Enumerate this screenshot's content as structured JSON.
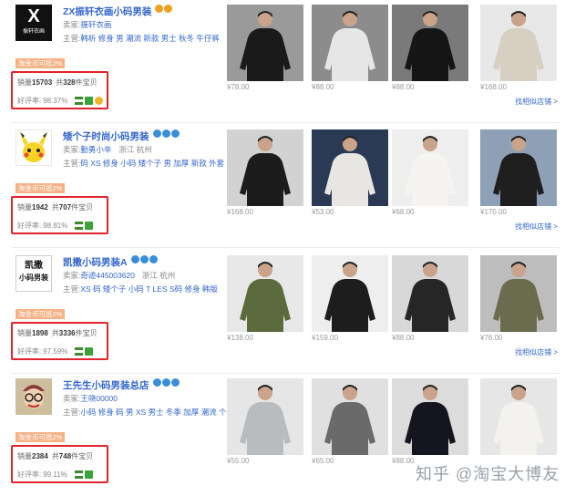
{
  "stores": [
    {
      "logo_text": [
        "X",
        "振轩衣画"
      ],
      "name": "ZX振轩衣画小码男装",
      "crowns": 2,
      "crown_color": "#f0a020",
      "seller_label": "卖家:",
      "seller_name": "振轩衣画",
      "location": "",
      "main_label": "主营:",
      "main_items": "韩析 修身 男 潮流 新款 男士 秋冬 牛仔裤",
      "badge": "淘金币可抵2%",
      "sales_label": "销量",
      "sales_value": "15703",
      "total_label": "共",
      "total_value": "328",
      "total_unit": "件宝贝",
      "rating_label": "好评率:",
      "rating_value": "98.37%",
      "rating_icons": [
        "list-icon",
        "shield-icon",
        "gold-medal-icon"
      ],
      "products": [
        {
          "price": "¥78.00",
          "bg": "#9a9a9a",
          "fg": "#1a1a1a"
        },
        {
          "price": "¥88.00",
          "bg": "#8c8c8c",
          "fg": "#e6e6e6"
        },
        {
          "price": "¥88.00",
          "bg": "#7a7a7a",
          "fg": "#151515"
        },
        {
          "price": "¥168.00",
          "bg": "#e8e8e8",
          "fg": "#d6cfc2"
        }
      ],
      "similar": "找相似店铺 >"
    },
    {
      "logo_text": [
        "Pikachu"
      ],
      "name": "矮个子时尚小码男装",
      "crowns": 3,
      "crown_color": "#3a8ed8",
      "seller_label": "卖家:",
      "seller_name": "勤勇小辛",
      "location": "浙江 杭州",
      "main_label": "主营:",
      "main_items": "码 XS 修身 小码 矮个子 男 加厚 新款 外套 上衣",
      "badge": "淘金币可抵2%",
      "sales_label": "销量",
      "sales_value": "1942",
      "total_label": "共",
      "total_value": "707",
      "total_unit": "件宝贝",
      "rating_label": "好评率:",
      "rating_value": "98.81%",
      "rating_icons": [
        "list-icon",
        "shield-icon"
      ],
      "products": [
        {
          "price": "¥168.00",
          "bg": "#d2d2d2",
          "fg": "#1c1c1c"
        },
        {
          "price": "¥53.00",
          "bg": "#2a3a55",
          "fg": "#e8e6e2"
        },
        {
          "price": "¥68.00",
          "bg": "#eeeeee",
          "fg": "#f6f4f0"
        },
        {
          "price": "¥170.00",
          "bg": "#8da0b5",
          "fg": "#1e1e1e"
        }
      ],
      "similar": "找相似店铺 >"
    },
    {
      "logo_text": [
        "凯撒",
        "小码男装"
      ],
      "name": "凯撒小码男装A",
      "crowns": 3,
      "crown_color": "#3a8ed8",
      "seller_label": "卖家:",
      "seller_name": "奇迹445003620",
      "location": "浙江 杭州",
      "main_label": "主营:",
      "main_items": "XS 码 矮个子 小码 T LES S码 修身 韩版",
      "badge": "淘金币可抵2%",
      "sales_label": "销量",
      "sales_value": "1898",
      "total_label": "共",
      "total_value": "3336",
      "total_unit": "件宝贝",
      "rating_label": "好评率:",
      "rating_value": "97.59%",
      "rating_icons": [
        "list-icon",
        "shield-icon"
      ],
      "products": [
        {
          "price": "¥138.00",
          "bg": "#e8e8e8",
          "fg": "#5c6b3e"
        },
        {
          "price": "¥159.00",
          "bg": "#eeeeee",
          "fg": "#1d1d1d"
        },
        {
          "price": "¥88.00",
          "bg": "#d8d8d8",
          "fg": "#262626"
        },
        {
          "price": "¥76.00",
          "bg": "#bdbdbd",
          "fg": "#6b6b4e"
        }
      ],
      "similar": "找相似店铺 >"
    },
    {
      "logo_text": [
        "Arale"
      ],
      "name": "王先生小码男装总店",
      "crowns": 3,
      "crown_color": "#3a8ed8",
      "seller_label": "卖家:",
      "seller_name": "王晓00000",
      "location": "",
      "main_label": "主营:",
      "main_items": "小码 修身 码 男 XS 男士 冬季 加厚 潮流 个",
      "badge": "淘金币可抵2%",
      "sales_label": "销量",
      "sales_value": "2384",
      "total_label": "共",
      "total_value": "748",
      "total_unit": "件宝贝",
      "rating_label": "好评率:",
      "rating_value": "99.11%",
      "rating_icons": [
        "list-icon",
        "shield-icon"
      ],
      "products": [
        {
          "price": "¥55.00",
          "bg": "#e6e6e6",
          "fg": "#b9bcbf"
        },
        {
          "price": "¥65.00",
          "bg": "#e0e0e0",
          "fg": "#6a6a6a"
        },
        {
          "price": "¥88.00",
          "bg": "#dcdcdc",
          "fg": "#151520"
        },
        {
          "price": "",
          "bg": "#e6e6e6",
          "fg": "#f4f2ee"
        }
      ],
      "similar": ""
    }
  ],
  "watermark": "知乎 @淘宝大博友"
}
